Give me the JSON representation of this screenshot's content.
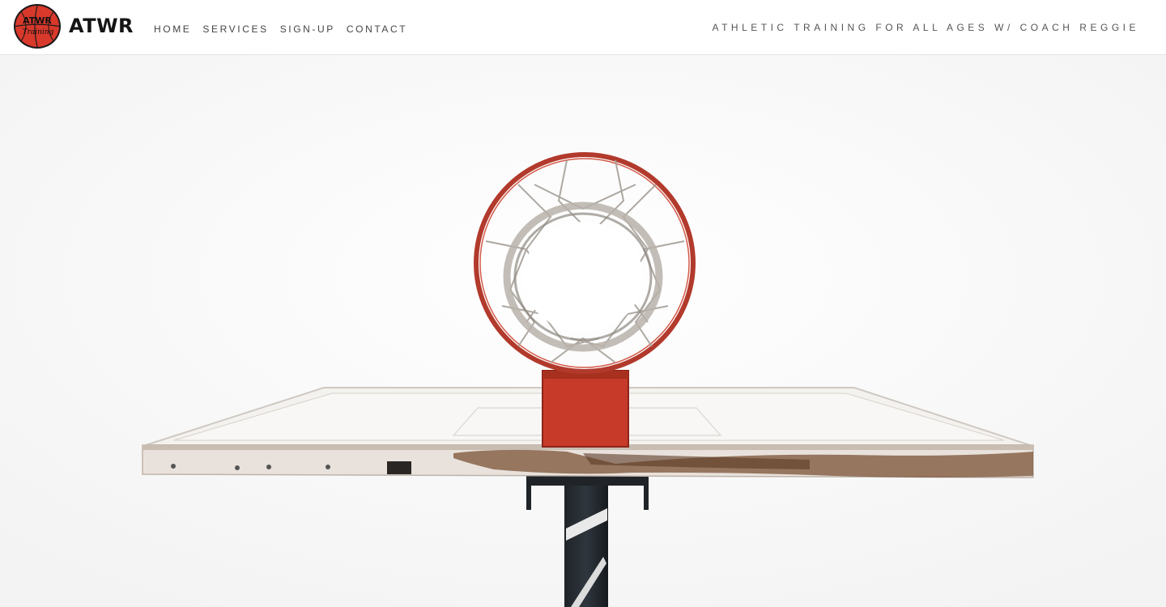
{
  "brand": {
    "badge_line1": "ATWR",
    "badge_line2": "Training",
    "name": "ATWR"
  },
  "nav": {
    "items": [
      {
        "label": "HOME"
      },
      {
        "label": "SERVICES"
      },
      {
        "label": "SIGN-UP"
      },
      {
        "label": "CONTACT"
      }
    ]
  },
  "tagline": "ATHLETIC TRAINING FOR ALL AGES W/ COACH REGGIE",
  "colors": {
    "accent_red": "#c8382c",
    "text_dark": "#151515",
    "hero_bg": "#fbfbfb"
  },
  "icons": {
    "logo": "basketball-badge-icon"
  }
}
